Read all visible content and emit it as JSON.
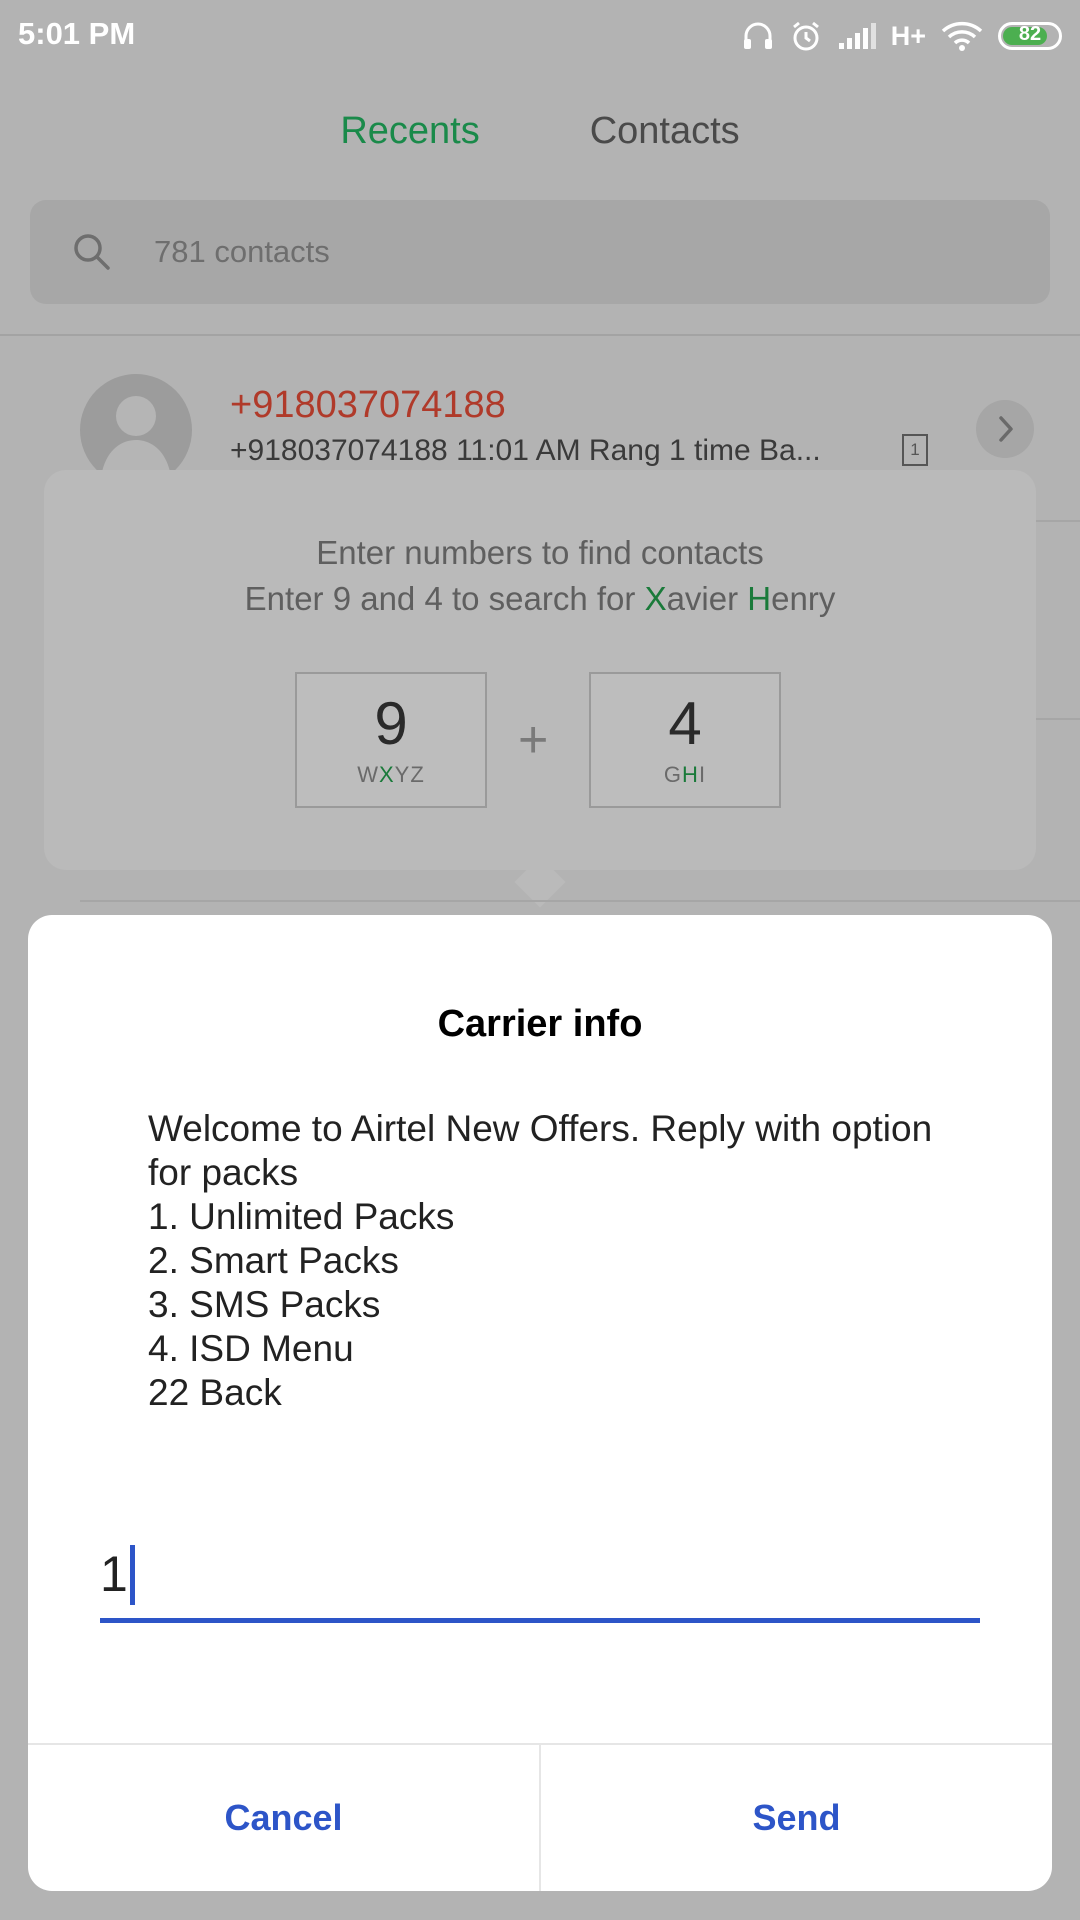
{
  "status_bar": {
    "time": "5:01 PM",
    "network": "H+",
    "battery": "82",
    "battery_level": 0.82,
    "icons": [
      "headset-icon",
      "alarm-icon",
      "signal-icon",
      "wifi-icon",
      "battery-icon"
    ]
  },
  "tabs": [
    {
      "label": "Recents",
      "active": true
    },
    {
      "label": "Contacts",
      "active": false
    }
  ],
  "search": {
    "placeholder": "781 contacts"
  },
  "call_entry": {
    "name": "+918037074188",
    "details": "+918037074188  11:01 AM Rang 1 time  Ba...",
    "sim": "1"
  },
  "hint_popup": {
    "line1": "Enter numbers to find contacts",
    "line2_parts": [
      "Enter 9 and 4 to search for ",
      "X",
      "avier ",
      "H",
      "enry"
    ],
    "keys": [
      {
        "digit": "9",
        "letters": [
          "W",
          "X",
          "YZ"
        ]
      },
      {
        "digit": "4",
        "letters": [
          "G",
          "H",
          "I"
        ]
      }
    ],
    "plus": "+"
  },
  "dialog": {
    "title": "Carrier info",
    "message": "Welcome to Airtel New Offers. Reply with option for packs\n1.  Unlimited Packs\n2.  Smart Packs\n3.  SMS Packs\n4.  ISD Menu\n22 Back",
    "input_value": "1",
    "cancel_label": "Cancel",
    "send_label": "Send"
  },
  "colors": {
    "accent_green": "#1a8a4a",
    "missed_red": "#b03a2a",
    "dialog_blue": "#2d55c8"
  }
}
